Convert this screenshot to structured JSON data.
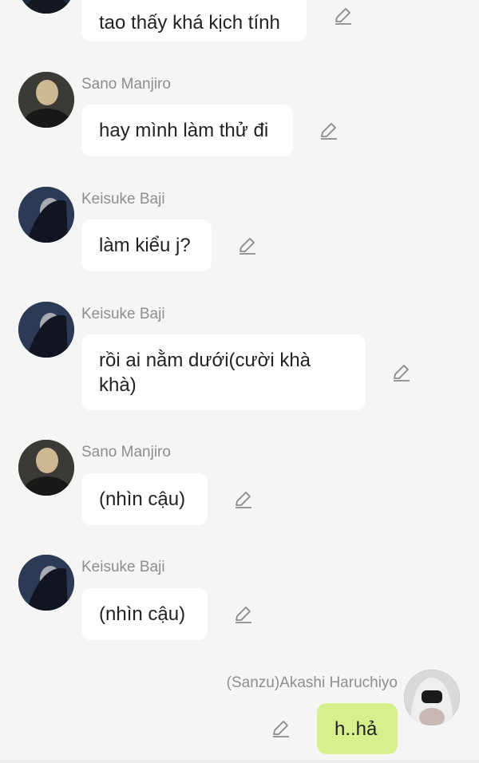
{
  "messages": [
    {
      "sender": "",
      "text": "tao thấy khá kịch tính",
      "avatar": "keisuke-baji-avatar"
    },
    {
      "sender": "Sano Manjiro",
      "text": "hay mình làm thử đi",
      "avatar": "sano-manjiro-avatar"
    },
    {
      "sender": "Keisuke Baji",
      "text": "làm kiểu j?",
      "avatar": "keisuke-baji-avatar"
    },
    {
      "sender": "Keisuke Baji",
      "text": "rồi ai nằm dưới(cười khà khà)",
      "avatar": "keisuke-baji-avatar"
    },
    {
      "sender": "Sano Manjiro",
      "text": "(nhìn cậu)",
      "avatar": "sano-manjiro-avatar"
    },
    {
      "sender": "Keisuke Baji",
      "text": "(nhìn cậu)",
      "avatar": "keisuke-baji-avatar"
    },
    {
      "sender": "(Sanzu)Akashi Haruchiyo",
      "text": "h..hả",
      "avatar": "akashi-haruchiyo-avatar"
    }
  ],
  "icons": {
    "edit": "pencil-edit-icon"
  },
  "colors": {
    "background": "#f5f5f5",
    "bubble_other": "#ffffff",
    "bubble_self": "#d7f08b",
    "sender_name": "#8e8e8e"
  }
}
